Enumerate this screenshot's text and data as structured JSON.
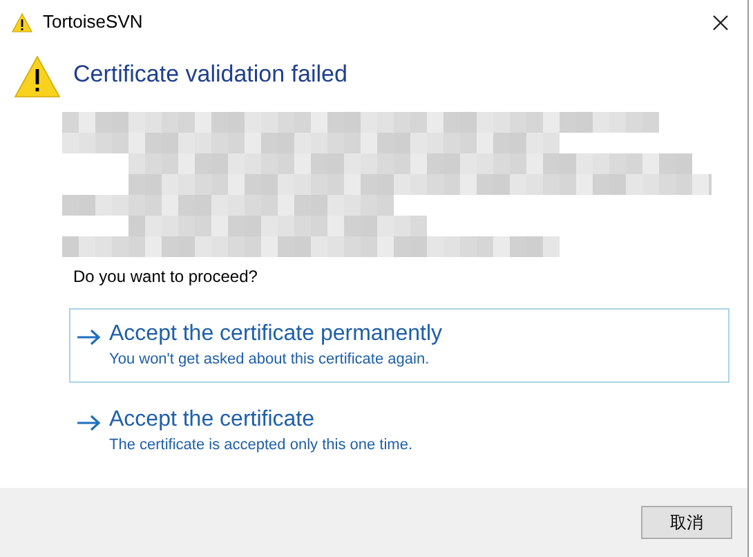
{
  "window": {
    "title": "TortoiseSVN"
  },
  "heading": "Certificate validation failed",
  "details": {
    "kind": "redacted"
  },
  "question": "Do you want to proceed?",
  "options": [
    {
      "title": "Accept the certificate permanently",
      "description": "You won't get asked about this certificate again.",
      "selected": true
    },
    {
      "title": "Accept the certificate",
      "description": "The certificate is accepted only this one time.",
      "selected": false
    }
  ],
  "buttons": [
    "取消"
  ]
}
